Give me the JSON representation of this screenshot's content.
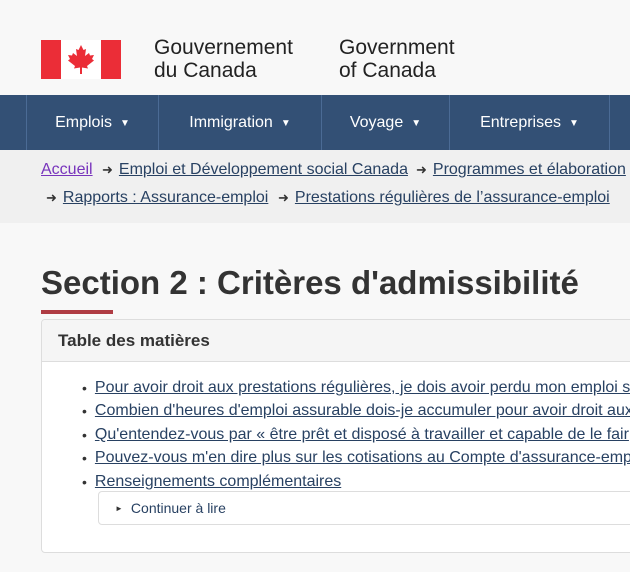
{
  "header": {
    "signature_fr_line1": "Gouvernement",
    "signature_fr_line2": "du Canada",
    "signature_en_line1": "Government",
    "signature_en_line2": "of Canada",
    "flag_icon": "canada-flag-icon"
  },
  "nav": {
    "items": [
      {
        "label": "Emplois"
      },
      {
        "label": "Immigration"
      },
      {
        "label": "Voyage"
      },
      {
        "label": "Entreprises"
      }
    ]
  },
  "breadcrumb": {
    "items": [
      {
        "label": "Accueil"
      },
      {
        "label": "Emploi et Développement social Canada"
      },
      {
        "label": "Programmes et élaboration"
      },
      {
        "label": "Rapports : Assurance-emploi"
      },
      {
        "label": "Prestations régulières de l’assurance-emploi"
      }
    ]
  },
  "page": {
    "title": "Section 2 : Critères d'admissibilité"
  },
  "toc": {
    "heading": "Table des matières",
    "items": [
      {
        "label": "Pour avoir droit aux prestations régulières, je dois avoir perdu mon emploi s"
      },
      {
        "label": "Combien d'heures d'emploi assurable dois-je accumuler pour avoir droit aux"
      },
      {
        "label": "Qu'entendez-vous par « être prêt et disposé à travailler et capable de le fair"
      },
      {
        "label": "Pouvez-vous m'en dire plus sur les cotisations au Compte d'assurance-emp"
      },
      {
        "label": "Renseignements complémentaires"
      }
    ],
    "details_label": "Continuer à lire"
  },
  "colors": {
    "nav_bg": "#335075",
    "link": "#284162",
    "visited_link": "#7834bc",
    "accent_red": "#af3c43",
    "flag_red": "#eb2d37"
  }
}
